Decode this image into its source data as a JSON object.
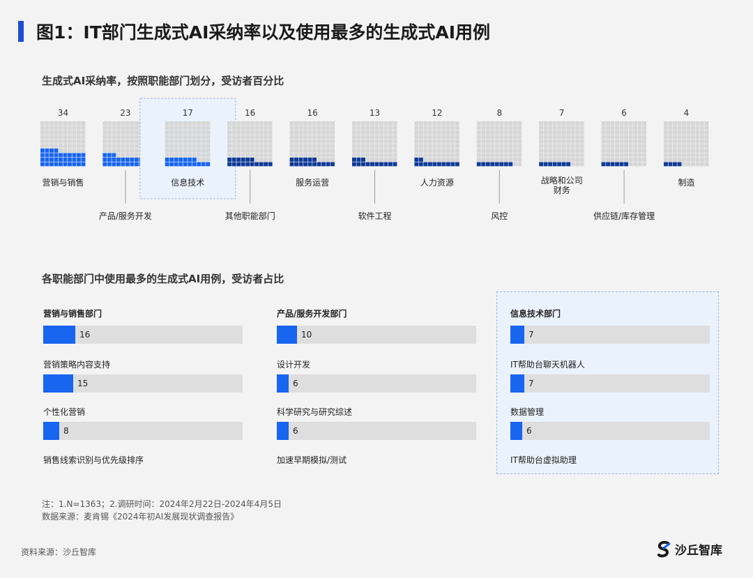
{
  "title": "图1：IT部门生成式AI采纳率以及使用最多的生成式AI用例",
  "colors": {
    "accent": "#1d4dd1",
    "adoption_light": "#1865f0",
    "adoption_dark": "#0f3a96",
    "empty_cell": "#d6d6d6",
    "bar": "#1865f0",
    "track": "#dedede",
    "highlight_bg": "#eaf2fc"
  },
  "chart_data": [
    {
      "type": "waffle",
      "title": "生成式AI采纳率，按照职能部门划分，受访者百分比",
      "unit": "%",
      "highlighted": "信息技术",
      "categories": [
        {
          "label": "营销与销售",
          "value": 34,
          "label_position": "top"
        },
        {
          "label": "产品/服务开发",
          "value": 23,
          "label_position": "bottom"
        },
        {
          "label": "信息技术",
          "value": 17,
          "label_position": "top"
        },
        {
          "label": "其他职能部门",
          "value": 16,
          "label_position": "bottom"
        },
        {
          "label": "服务运营",
          "value": 16,
          "label_position": "top"
        },
        {
          "label": "软件工程",
          "value": 13,
          "label_position": "bottom"
        },
        {
          "label": "人力资源",
          "value": 12,
          "label_position": "top"
        },
        {
          "label": "风控",
          "value": 8,
          "label_position": "bottom"
        },
        {
          "label": "战略和公司\n财务",
          "value": 7,
          "label_position": "top"
        },
        {
          "label": "供应链/库存管理",
          "value": 6,
          "label_position": "bottom"
        },
        {
          "label": "制造",
          "value": 4,
          "label_position": "top"
        }
      ]
    },
    {
      "type": "bar",
      "title": "各职能部门中使用最多的生成式AI用例，受访者占比",
      "xlim": [
        0,
        100
      ],
      "panels": [
        {
          "title": "营销与销售部门",
          "highlighted": false,
          "items": [
            {
              "value": 16,
              "label": "营销策略内容支持"
            },
            {
              "value": 15,
              "label": "个性化营销"
            },
            {
              "value": 8,
              "label": "销售线索识别与优先级排序"
            }
          ]
        },
        {
          "title": "产品/服务开发部门",
          "highlighted": false,
          "items": [
            {
              "value": 10,
              "label": "设计开发"
            },
            {
              "value": 6,
              "label": "科学研究与研究综述"
            },
            {
              "value": 6,
              "label": "加速早期模拟/测试"
            }
          ]
        },
        {
          "title": "信息技术部门",
          "highlighted": true,
          "items": [
            {
              "value": 7,
              "label": "IT帮助台聊天机器人"
            },
            {
              "value": 7,
              "label": "数据管理"
            },
            {
              "value": 6,
              "label": "IT帮助台虚拟助理"
            }
          ]
        }
      ]
    }
  ],
  "notes": {
    "line1": "注：1.N=1363；2.调研时间：2024年2月22日-2024年4月5日",
    "line2": "数据来源：麦肯锡《2024年初AI发展现状调查报告》"
  },
  "source": "资料来源：沙丘智库",
  "logo": {
    "text": "沙丘智库",
    "icon": "dune-s-logo-icon"
  }
}
